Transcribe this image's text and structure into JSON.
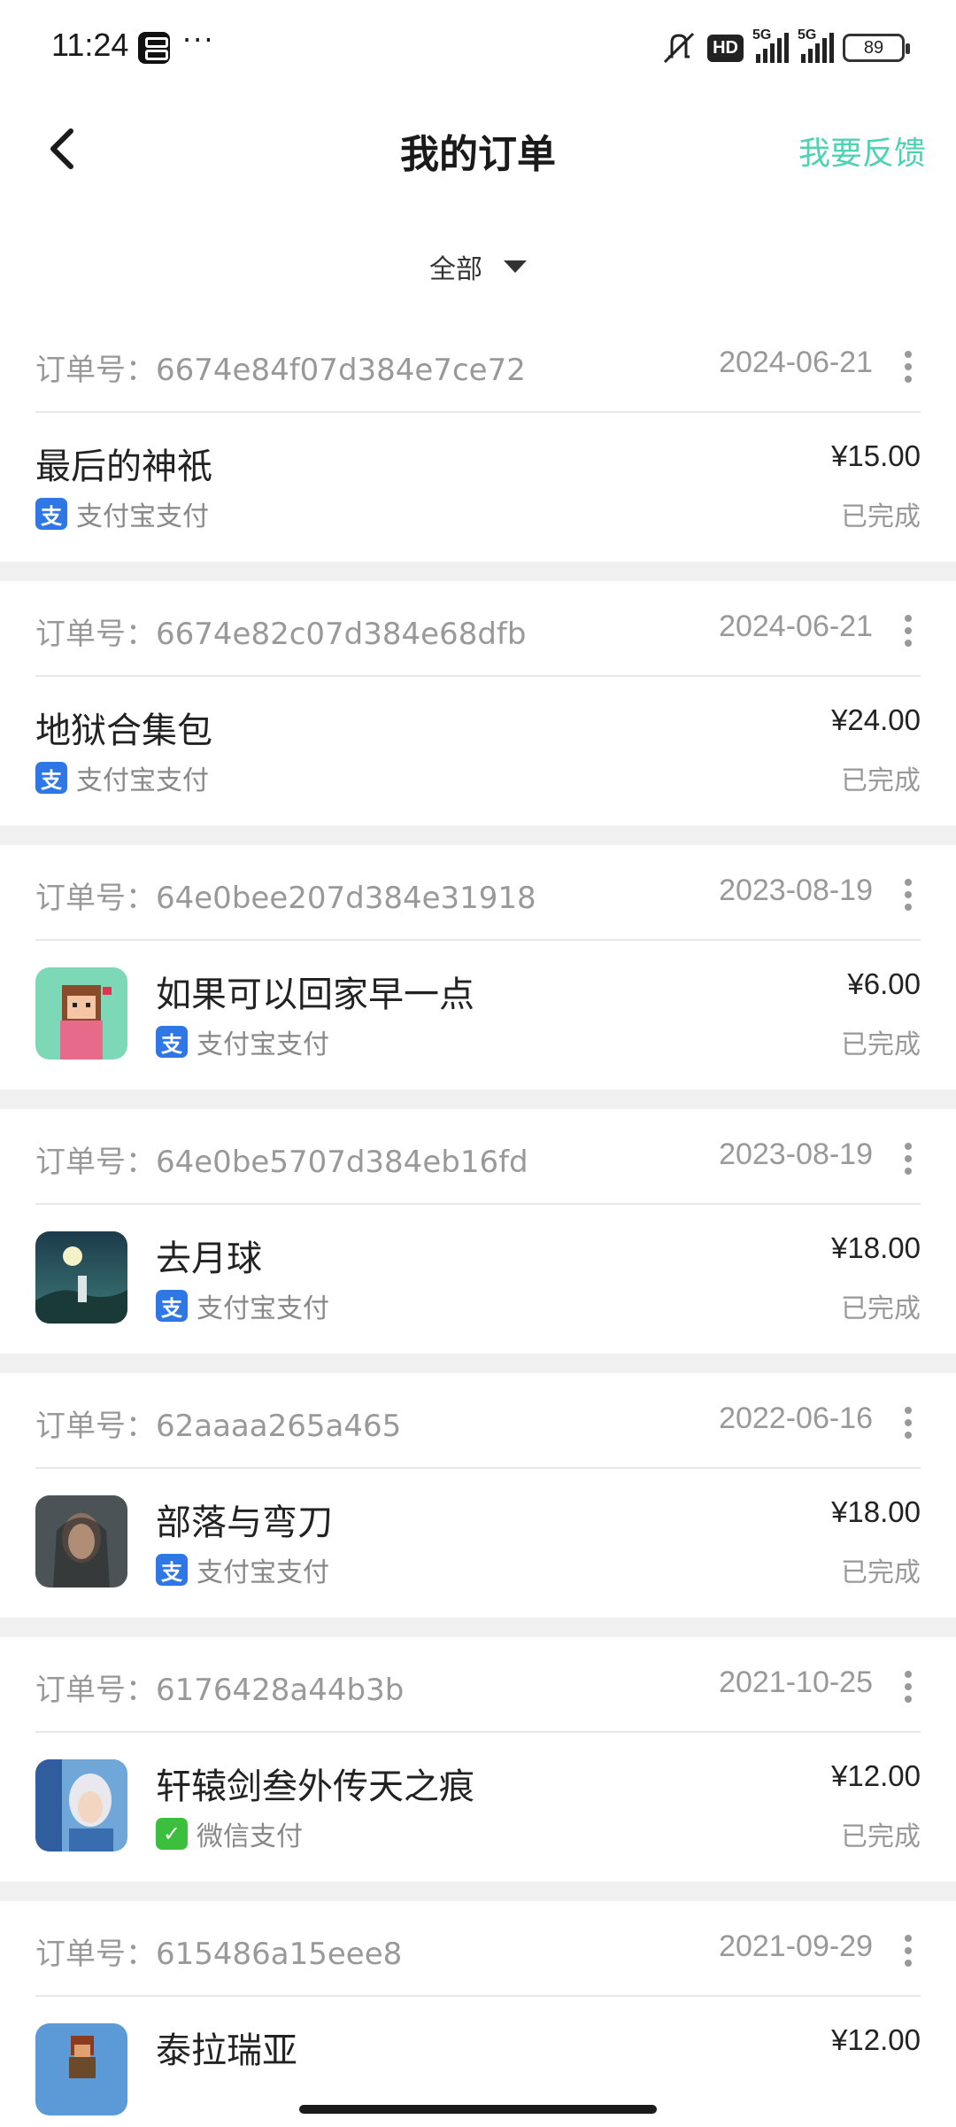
{
  "status_bar": {
    "time": "11:24",
    "network_1": "5G",
    "network_2": "5G",
    "hd": "HD",
    "battery": "89"
  },
  "header": {
    "title": "我的订单",
    "feedback": "我要反馈"
  },
  "filter": {
    "label": "全部"
  },
  "orders": [
    {
      "order_no": "订单号：6674e84f07d384e7ce72",
      "date": "2024-06-21",
      "name": "最后的神祇",
      "price": "¥15.00",
      "status": "已完成",
      "payment": "支付宝支付",
      "pay_icon_char": "支",
      "has_thumb": false
    },
    {
      "order_no": "订单号：6674e82c07d384e68dfb",
      "date": "2024-06-21",
      "name": "地狱合集包",
      "price": "¥24.00",
      "status": "已完成",
      "payment": "支付宝支付",
      "pay_icon_char": "支",
      "has_thumb": false
    },
    {
      "order_no": "订单号：64e0bee207d384e31918",
      "date": "2023-08-19",
      "name": "如果可以回家早一点",
      "price": "¥6.00",
      "status": "已完成",
      "payment": "支付宝支付",
      "pay_icon_char": "支",
      "has_thumb": true
    },
    {
      "order_no": "订单号：64e0be5707d384eb16fd",
      "date": "2023-08-19",
      "name": "去月球",
      "price": "¥18.00",
      "status": "已完成",
      "payment": "支付宝支付",
      "pay_icon_char": "支",
      "has_thumb": true
    },
    {
      "order_no": "订单号：62aaaa265a465",
      "date": "2022-06-16",
      "name": "部落与弯刀",
      "price": "¥18.00",
      "status": "已完成",
      "payment": "支付宝支付",
      "pay_icon_char": "支",
      "has_thumb": true
    },
    {
      "order_no": "订单号：6176428a44b3b",
      "date": "2021-10-25",
      "name": "轩辕剑叁外传天之痕",
      "price": "¥12.00",
      "status": "已完成",
      "payment": "微信支付",
      "pay_icon_char": "✓",
      "has_thumb": true
    },
    {
      "order_no": "订单号：615486a15eee8",
      "date": "2021-09-29",
      "name": "泰拉瑞亚",
      "price": "¥12.00",
      "status": "",
      "payment": "",
      "pay_icon_char": "",
      "has_thumb": true
    }
  ],
  "colors": {
    "accent": "#4fd1b3",
    "alipay": "#2e77e5",
    "wechat": "#3cbf3c",
    "separator": "#f0f0f0"
  },
  "icons": {
    "back": "chevron-left-icon",
    "filter": "caret-down-icon",
    "more": "more-vertical-icon"
  }
}
